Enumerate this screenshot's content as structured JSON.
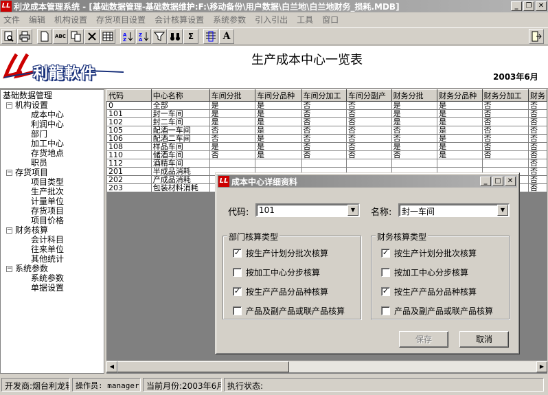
{
  "window": {
    "title": "利龙成本管理系统 - [基础数据管理-基础数据维护:F:\\移动备份\\用户数据\\白兰地\\白兰地财务_损耗.MDB]"
  },
  "menu": [
    "文件",
    "编辑",
    "机构设置",
    "存货项目设置",
    "会计核算设置",
    "系统参数",
    "引入引出",
    "工具",
    "窗口"
  ],
  "toolbar_text": {
    "abc": "ABC",
    "sigma": "Σ",
    "font": "A"
  },
  "banner": {
    "logo": "利龍軟件",
    "title": "生产成本中心一览表",
    "date": "2003年6月"
  },
  "tree": {
    "root": "基础数据管理",
    "groups": [
      {
        "label": "机构设置",
        "items": [
          "成本中心",
          "利润中心",
          "部门",
          "加工中心",
          "存货地点",
          "职员"
        ]
      },
      {
        "label": "存货项目",
        "items": [
          "项目类型",
          "生产批次",
          "计量单位",
          "存货项目",
          "项目价格"
        ]
      },
      {
        "label": "财务核算",
        "items": [
          "会计科目",
          "往来单位",
          "其他统计"
        ]
      },
      {
        "label": "系统参数",
        "items": [
          "系统参数",
          "单据设置"
        ]
      }
    ]
  },
  "table": {
    "columns": [
      "代码",
      "中心名称",
      "车间分批",
      "车间分品种",
      "车间分加工",
      "车间分副产",
      "财务分批",
      "财务分品种",
      "财务分加工",
      "财务"
    ],
    "rows": [
      [
        "0",
        "全部",
        "是",
        "是",
        "否",
        "否",
        "是",
        "是",
        "否",
        "否"
      ],
      [
        "101",
        "封一车间",
        "是",
        "是",
        "否",
        "否",
        "是",
        "是",
        "否",
        "否"
      ],
      [
        "102",
        "封二车间",
        "是",
        "是",
        "否",
        "否",
        "是",
        "是",
        "否",
        "否"
      ],
      [
        "105",
        "配酒一车间",
        "否",
        "是",
        "否",
        "否",
        "否",
        "是",
        "否",
        "否"
      ],
      [
        "106",
        "配酒二车间",
        "否",
        "是",
        "否",
        "否",
        "否",
        "是",
        "否",
        "否"
      ],
      [
        "108",
        "样品车间",
        "是",
        "是",
        "否",
        "否",
        "是",
        "是",
        "否",
        "否"
      ],
      [
        "110",
        "储酒车间",
        "否",
        "是",
        "否",
        "否",
        "否",
        "是",
        "否",
        "否"
      ],
      [
        "112",
        "酒精车间",
        "",
        "",
        "",
        "",
        "",
        "",
        "",
        "否"
      ],
      [
        "201",
        "半成品消耗",
        "",
        "",
        "",
        "",
        "",
        "",
        "",
        "否"
      ],
      [
        "202",
        "产成品消耗",
        "",
        "",
        "",
        "",
        "",
        "",
        "",
        "否"
      ],
      [
        "203",
        "包装材料消耗",
        "",
        "",
        "",
        "",
        "",
        "",
        "",
        "否"
      ]
    ]
  },
  "status": {
    "developer": "开发商:烟台利龙软",
    "operator": "操作员: manager",
    "month": "当前月份:2003年6月",
    "exec": "执行状态:"
  },
  "dialog": {
    "title": "成本中心详细资料",
    "code_label": "代码:",
    "code_value": "101",
    "name_label": "名称:",
    "name_value": "封一车间",
    "dept_group": {
      "title": "部门核算类型",
      "options": [
        {
          "label": "按生产计划分批次核算",
          "checked": true
        },
        {
          "label": "按加工中心分步核算",
          "checked": false
        },
        {
          "label": "按生产产品分品种核算",
          "checked": true
        },
        {
          "label": "产品及副产品或联产品核算",
          "checked": false
        }
      ]
    },
    "fin_group": {
      "title": "财务核算类型",
      "options": [
        {
          "label": "按生产计划分批次核算",
          "checked": true
        },
        {
          "label": "按加工中心分步核算",
          "checked": false
        },
        {
          "label": "按生产产品分品种核算",
          "checked": true
        },
        {
          "label": "产品及副产品或联产品核算",
          "checked": false
        }
      ]
    },
    "save": "保存",
    "cancel": "取消"
  }
}
